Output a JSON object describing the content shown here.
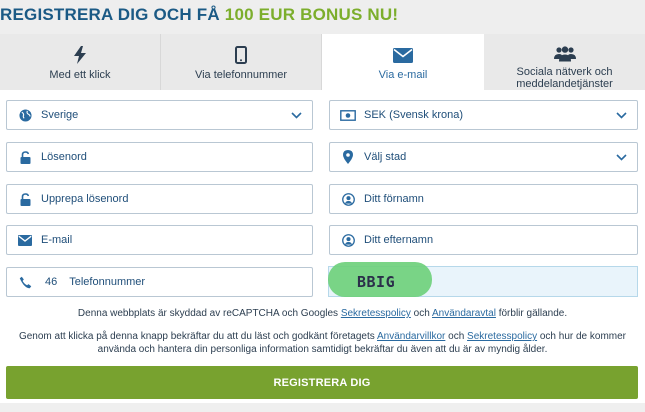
{
  "header": {
    "title_prefix": "REGISTRERA DIG OCH FÅ",
    "title_highlight": "100 EUR BONUS NU!"
  },
  "tabs": [
    {
      "label": "Med ett klick",
      "icon": "bolt-icon"
    },
    {
      "label": "Via telefonnummer",
      "icon": "phone-icon"
    },
    {
      "label": "Via e-mail",
      "icon": "envelope-icon",
      "active": true
    },
    {
      "label": "Sociala nätverk och meddelandetjänster",
      "icon": "users-icon"
    }
  ],
  "form": {
    "country": "Sverige",
    "currency": "SEK (Svensk krona)",
    "password_placeholder": "Lösenord",
    "city_placeholder": "Välj stad",
    "repeat_password_placeholder": "Upprepa lösenord",
    "first_name_placeholder": "Ditt förnamn",
    "email_placeholder": "E-mail",
    "last_name_placeholder": "Ditt efternamn",
    "phone_code": "46",
    "phone_placeholder": "Telefonnummer",
    "captcha_text": "BBIG"
  },
  "notes": {
    "recaptcha_pre": "Denna webbplats är skyddad av reCAPTCHA och Googles",
    "recaptcha_link1": "Sekretesspolicy",
    "recaptcha_mid": "och",
    "recaptcha_link2": "Användaravtal",
    "recaptcha_post": "förblir gällande.",
    "terms_pre": "Genom att klicka på denna knapp bekräftar du att du läst och godkänt företagets",
    "terms_link1": "Användarvillkor",
    "terms_mid": "och",
    "terms_link2": "Sekretesspolicy",
    "terms_post": "och hur de kommer använda och hantera din personliga information samtidigt bekräftar du även att du är av myndig ålder."
  },
  "submit_label": "REGISTRERA DIG",
  "colors": {
    "primary": "#1b5a85",
    "accent": "#7cae2c",
    "button": "#78a22f"
  }
}
